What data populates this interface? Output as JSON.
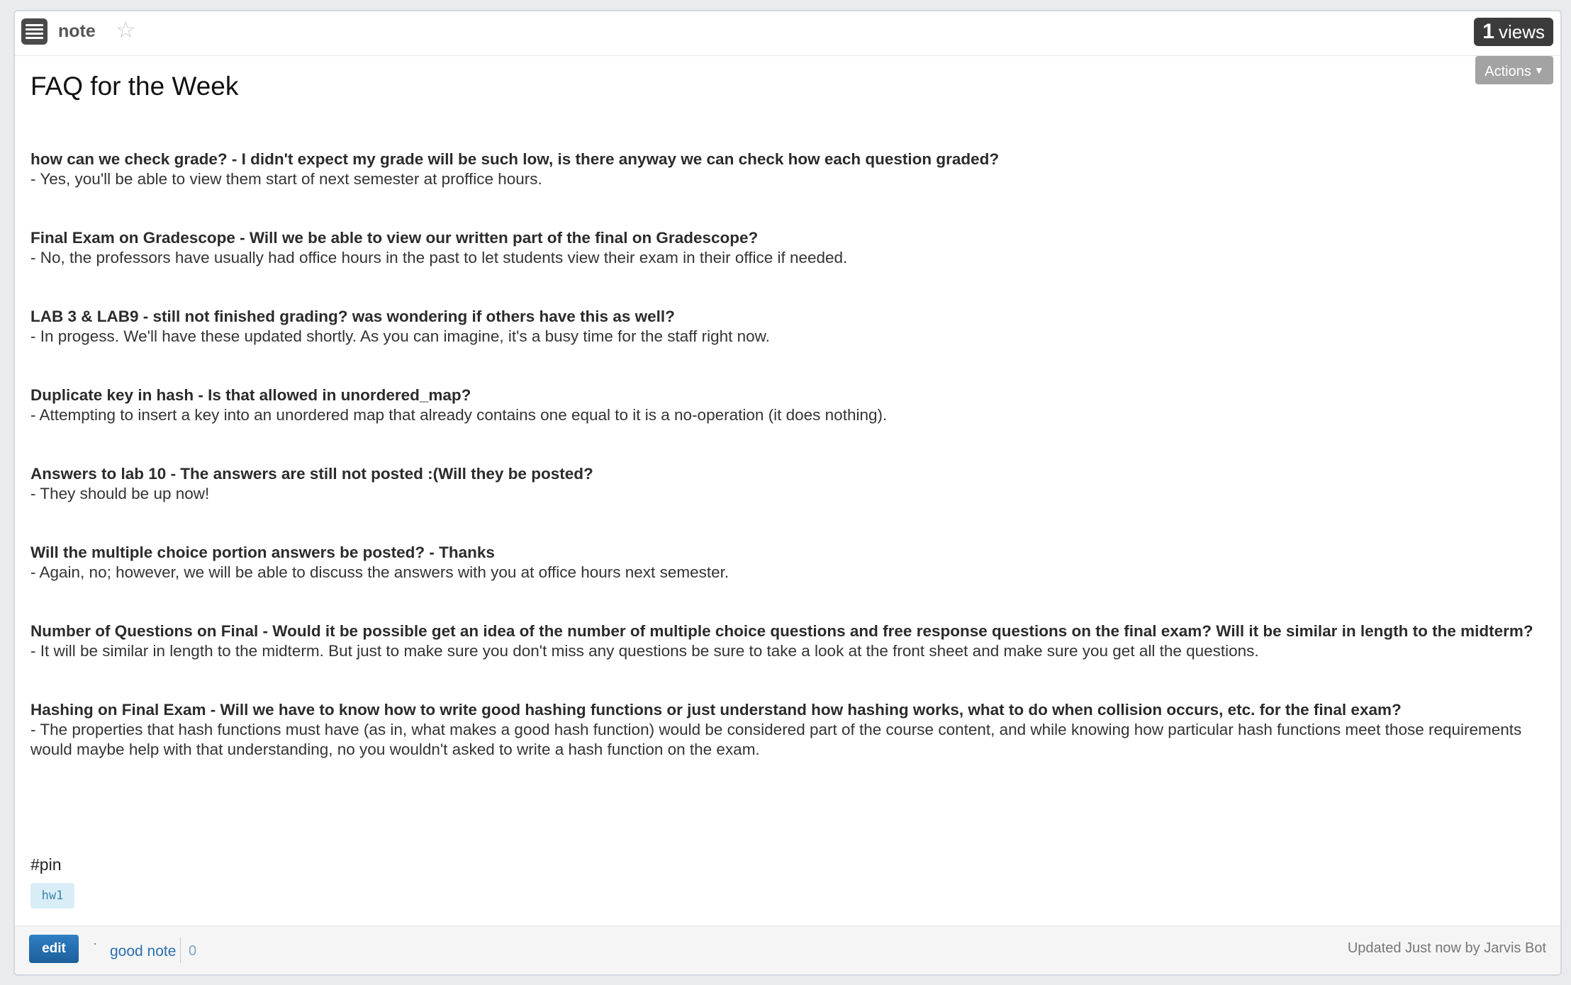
{
  "header": {
    "post_type": "note",
    "views_count": "1",
    "views_label": "views",
    "actions_label": "Actions"
  },
  "post": {
    "title": "FAQ for the Week",
    "faq": [
      {
        "question": "how can we check grade? - I didn't expect my grade will be such low, is there anyway we can check how each question graded?",
        "answer": "- Yes, you'll be able to view them start of next semester at proffice hours."
      },
      {
        "question": "Final Exam on Gradescope - Will we be able to view our written part of the final on Gradescope?",
        "answer": "- No, the professors have usually had office hours in the past to let students view their exam in their office if needed."
      },
      {
        "question": "LAB 3 & LAB9 - still not finished grading? was wondering if others have this as well?",
        "answer": "- In progess. We'll have these updated shortly. As you can imagine, it's a busy time for the staff right now."
      },
      {
        "question": "Duplicate key in hash - Is that allowed in unordered_map?",
        "answer": "- Attempting to insert a key into an unordered map that already contains one equal to it is a no-operation (it does nothing)."
      },
      {
        "question": "Answers to lab 10 - The answers are still not posted :(Will they be posted?",
        "answer": "- They should be up now!"
      },
      {
        "question": "Will the multiple choice portion answers be posted? - Thanks",
        "answer": "- Again, no; however, we will be able to discuss the answers with you at office hours next semester."
      },
      {
        "question": "Number of Questions on Final - Would it be possible get an idea of the number of multiple choice questions and free response questions on the final exam? Will it be similar in length to the midterm?",
        "answer": "- It will be similar in length to the midterm.  But just to make sure you don't miss any questions be sure to take a look at the front sheet and make sure you get all the questions."
      },
      {
        "question": "Hashing on Final Exam - Will we have to know how to write good hashing functions or just understand how hashing works, what to do when collision occurs, etc. for the final exam?",
        "answer": "- The properties that hash functions must have (as in, what makes a good hash function) would be considered part of the course content, and while knowing how particular hash functions meet those requirements would maybe help with that understanding, no you wouldn't asked to write a hash function on the exam."
      }
    ],
    "pin_text": "#pin",
    "tag": "hw1"
  },
  "footer": {
    "edit_label": "edit",
    "dot": "·",
    "good_note_label": "good note",
    "good_note_count": "0",
    "updated_text": "Updated Just now by Jarvis Bot"
  }
}
